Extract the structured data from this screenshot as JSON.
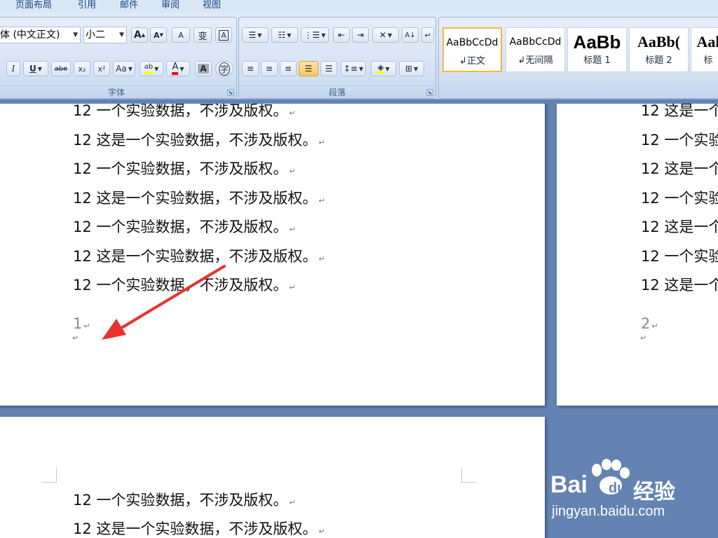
{
  "tabs": [
    "页面布局",
    "引用",
    "邮件",
    "审阅",
    "视图"
  ],
  "font_group": {
    "label": "字体",
    "font_name": "体 (中文正文)",
    "font_size": "小二",
    "btn_grow": "A",
    "btn_shrink": "A",
    "btn_clear": "A",
    "btn_phonetic": "变",
    "btn_border": "A",
    "btn_italic": "I",
    "btn_underline": "U",
    "btn_strike": "abe",
    "btn_sub": "x₂",
    "btn_sup": "x²",
    "btn_case": "Aa",
    "btn_highlight": "ab",
    "btn_fontcolor": "A",
    "btn_shade": "A",
    "btn_enclose": "字"
  },
  "para_group": {
    "label": "段落",
    "btn_sort": "A↓",
    "btn_show_marks": "↵"
  },
  "styles": [
    {
      "sample": "AaBbCcDd",
      "name": "↲正文"
    },
    {
      "sample": "AaBbCcDd",
      "name": "↲无间隔"
    },
    {
      "sample": "AaBb",
      "name": "标题 1"
    },
    {
      "sample": "AaBb(",
      "name": "标题 2"
    },
    {
      "sample": "Aal",
      "name": "标"
    }
  ],
  "page1": {
    "lines": [
      "12 一个实验数据，不涉及版权。",
      "12 这是一个实验数据，不涉及版权。",
      "12 一个实验数据，不涉及版权。",
      "12 这是一个实验数据，不涉及版权。",
      "12 一个实验数据，不涉及版权。",
      "12 这是一个实验数据，不涉及版权。",
      "12 一个实验数据，不涉及版权。"
    ],
    "page_number": "1"
  },
  "page2": {
    "lines": [
      "12 这是一个",
      "12 一个实验",
      "12 这是一个",
      "12 一个实验",
      "12 这是一个",
      "12 一个实验",
      "12 这是一个"
    ],
    "page_number": "2"
  },
  "page3": {
    "lines": [
      "12 一个实验数据，不涉及版权。",
      "12 这是一个实验数据，不涉及版权。"
    ]
  },
  "marks": {
    "paragraph": "↵"
  },
  "watermark": {
    "brand": "Bai",
    "brand_end": "du",
    "suffix": "经验",
    "url": "jingyan.baidu.com"
  },
  "colors": {
    "arrow": "#e8322b",
    "highlight": "#ffff00",
    "font_color": "#ff0000",
    "doc_bg": "#6383b3"
  }
}
